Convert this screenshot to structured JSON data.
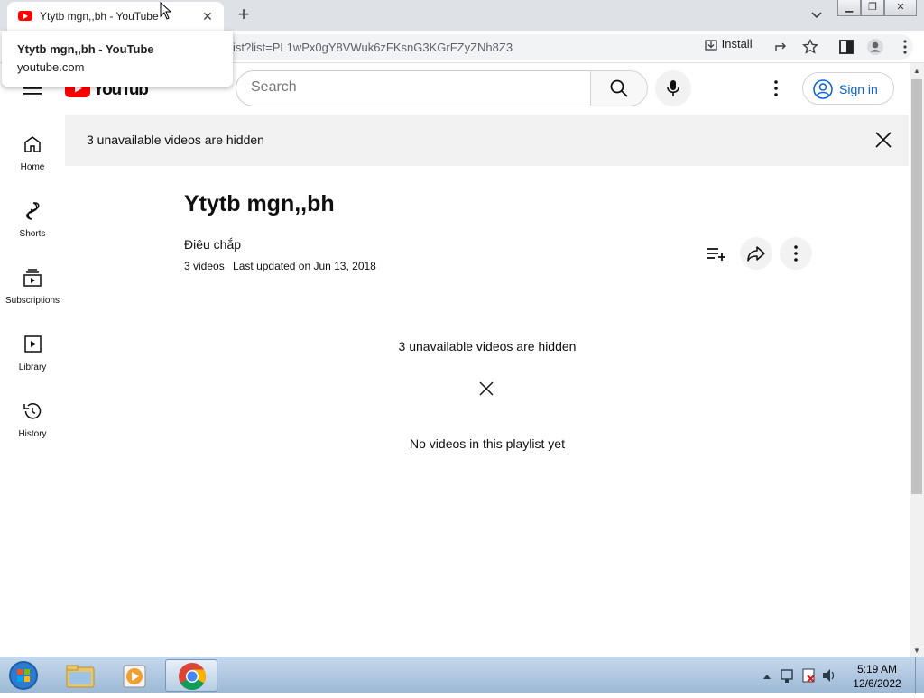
{
  "browser": {
    "tab_title": "Ytytb mgn,,bh - YouTube",
    "hovercard_title": "Ytytb mgn,,bh - YouTube",
    "hovercard_domain": "youtube.com",
    "url": "ist?list=PL1wPx0gY8VWuk6zFKsnG3KGrFZyZNh8Z3",
    "install_label": "Install"
  },
  "header": {
    "search_placeholder": "Search",
    "signin_label": "Sign in"
  },
  "sidebar": {
    "items": [
      {
        "label": "Home"
      },
      {
        "label": "Shorts"
      },
      {
        "label": "Subscriptions"
      },
      {
        "label": "Library"
      },
      {
        "label": "History"
      }
    ]
  },
  "banner": {
    "text": "3 unavailable videos are hidden"
  },
  "playlist": {
    "title": "Ytytb mgn,,bh",
    "owner": "Điêu chắp",
    "video_count": "3 videos",
    "updated": "Last updated on Jun 13, 2018",
    "hidden_notice": "3 unavailable videos are hidden",
    "empty_message": "No videos in this playlist yet"
  },
  "taskbar": {
    "time": "5:19 AM",
    "date": "12/6/2022"
  },
  "colors": {
    "youtube_red": "#ff0000",
    "link_blue": "#065fd4"
  }
}
